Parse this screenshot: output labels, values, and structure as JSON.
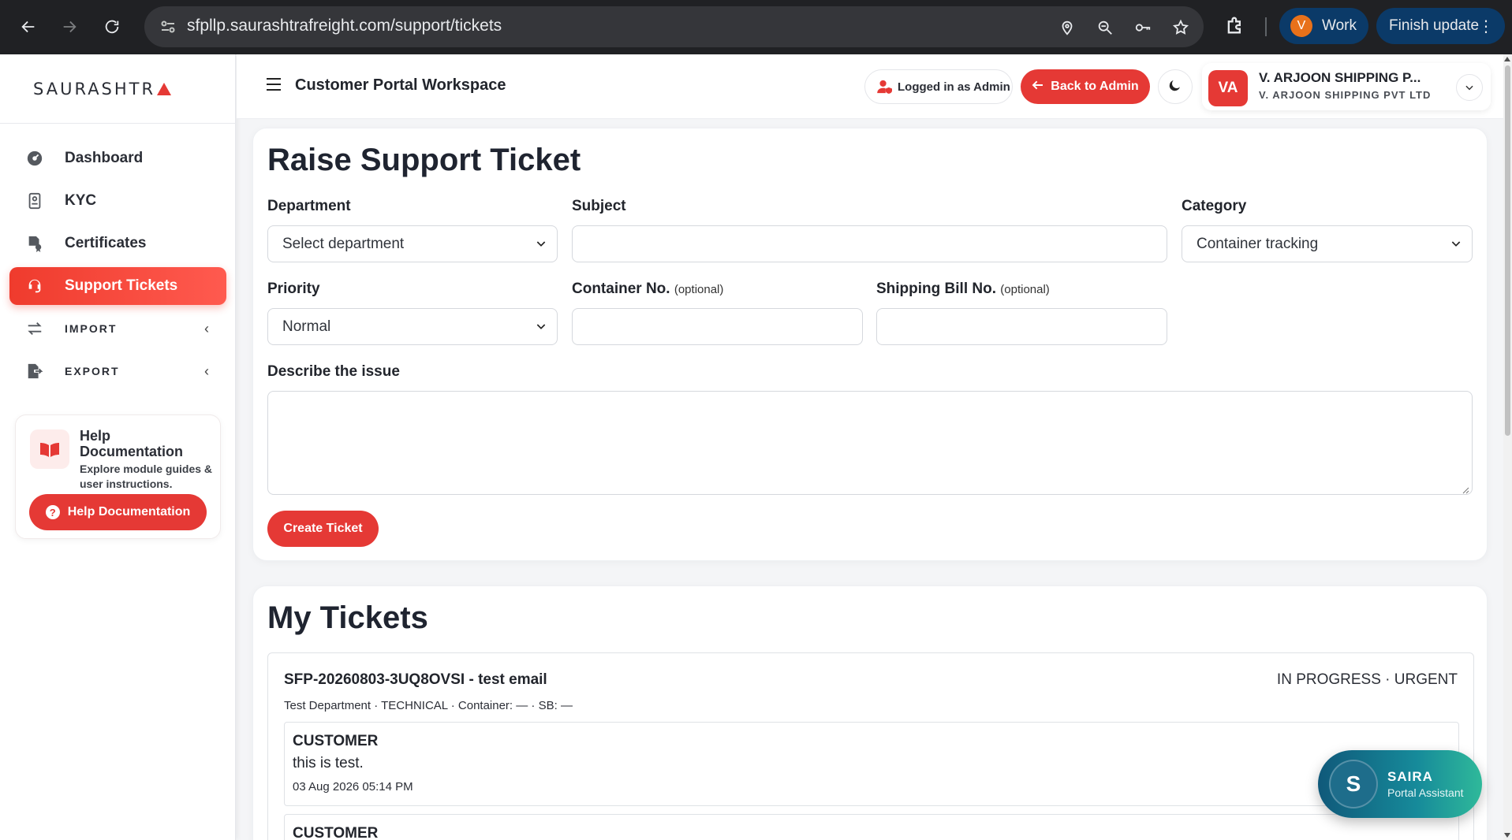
{
  "browser": {
    "url": "sfpllp.saurashtrafreight.com/support/tickets",
    "profile_initial": "V",
    "profile_label": "Work",
    "update_label": "Finish update"
  },
  "sidebar": {
    "brand": "SAURASHTR",
    "items": [
      {
        "label": "Dashboard",
        "icon": "dashboard-icon"
      },
      {
        "label": "KYC",
        "icon": "id-card-icon"
      },
      {
        "label": "Certificates",
        "icon": "certificate-icon"
      },
      {
        "label": "Support Tickets",
        "icon": "headset-icon"
      },
      {
        "label": "IMPORT",
        "icon": "swap-icon"
      },
      {
        "label": "EXPORT",
        "icon": "export-icon"
      }
    ],
    "help": {
      "title": "Help Documentation",
      "description": "Explore module guides & user instructions.",
      "button": "Help Documentation"
    }
  },
  "header": {
    "title": "Customer Portal Workspace",
    "logged_in": "Logged in as Admin",
    "back": "Back to Admin",
    "account": {
      "initials": "VA",
      "name": "V. ARJOON SHIPPING P...",
      "company": "V. ARJOON SHIPPING PVT LTD"
    }
  },
  "raise": {
    "title": "Raise Support Ticket",
    "department_label": "Department",
    "department_value": "Select department",
    "subject_label": "Subject",
    "subject_value": "",
    "category_label": "Category",
    "category_value": "Container tracking",
    "priority_label": "Priority",
    "priority_value": "Normal",
    "container_label": "Container No.",
    "shipping_label": "Shipping Bill No.",
    "optional": "(optional)",
    "describe_label": "Describe the issue",
    "create_button": "Create Ticket"
  },
  "tickets": {
    "title": "My Tickets",
    "items": [
      {
        "id_subject": "SFP-20260803-3UQ8OVSI - test email",
        "status": "IN PROGRESS · URGENT",
        "meta": "Test Department · TECHNICAL · Container: — · SB: —",
        "messages": [
          {
            "role": "CUSTOMER",
            "text": "this is test.",
            "time": "03 Aug 2026 05:14 PM"
          },
          {
            "role": "CUSTOMER",
            "text": "",
            "time": ""
          }
        ]
      }
    ]
  },
  "assistant": {
    "initial": "S",
    "name": "SAIRA",
    "subtitle": "Portal Assistant"
  },
  "colors": {
    "accent": "#e53935",
    "chrome": "#202124",
    "assistant_start": "#10597a",
    "assistant_end": "#2fb99a"
  }
}
